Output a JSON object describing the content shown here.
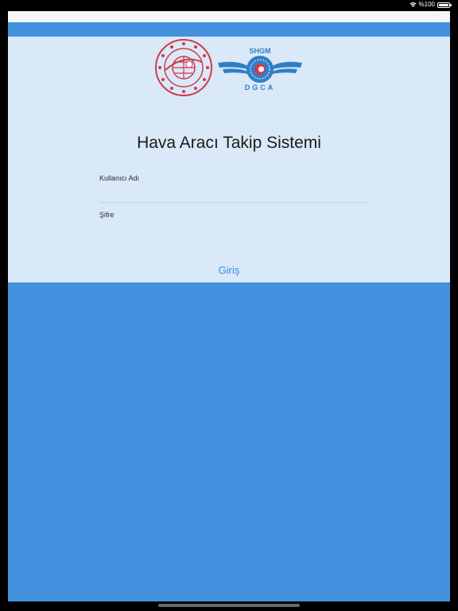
{
  "status_bar": {
    "battery_text": "%100"
  },
  "app": {
    "title": "Hava Aracı Takip Sistemi",
    "username_label": "Kullanıcı Adı",
    "username_value": "",
    "password_label": "Şifre",
    "password_value": "",
    "login_label": "Giriş"
  },
  "logos": {
    "dgca_top_text": "SHGM",
    "dgca_bottom_text": "DGCA"
  },
  "colors": {
    "accent_blue": "#4391de",
    "card_background": "#dae9f7",
    "seal_red": "#d03a4a",
    "dgca_blue": "#2f7fc8"
  }
}
